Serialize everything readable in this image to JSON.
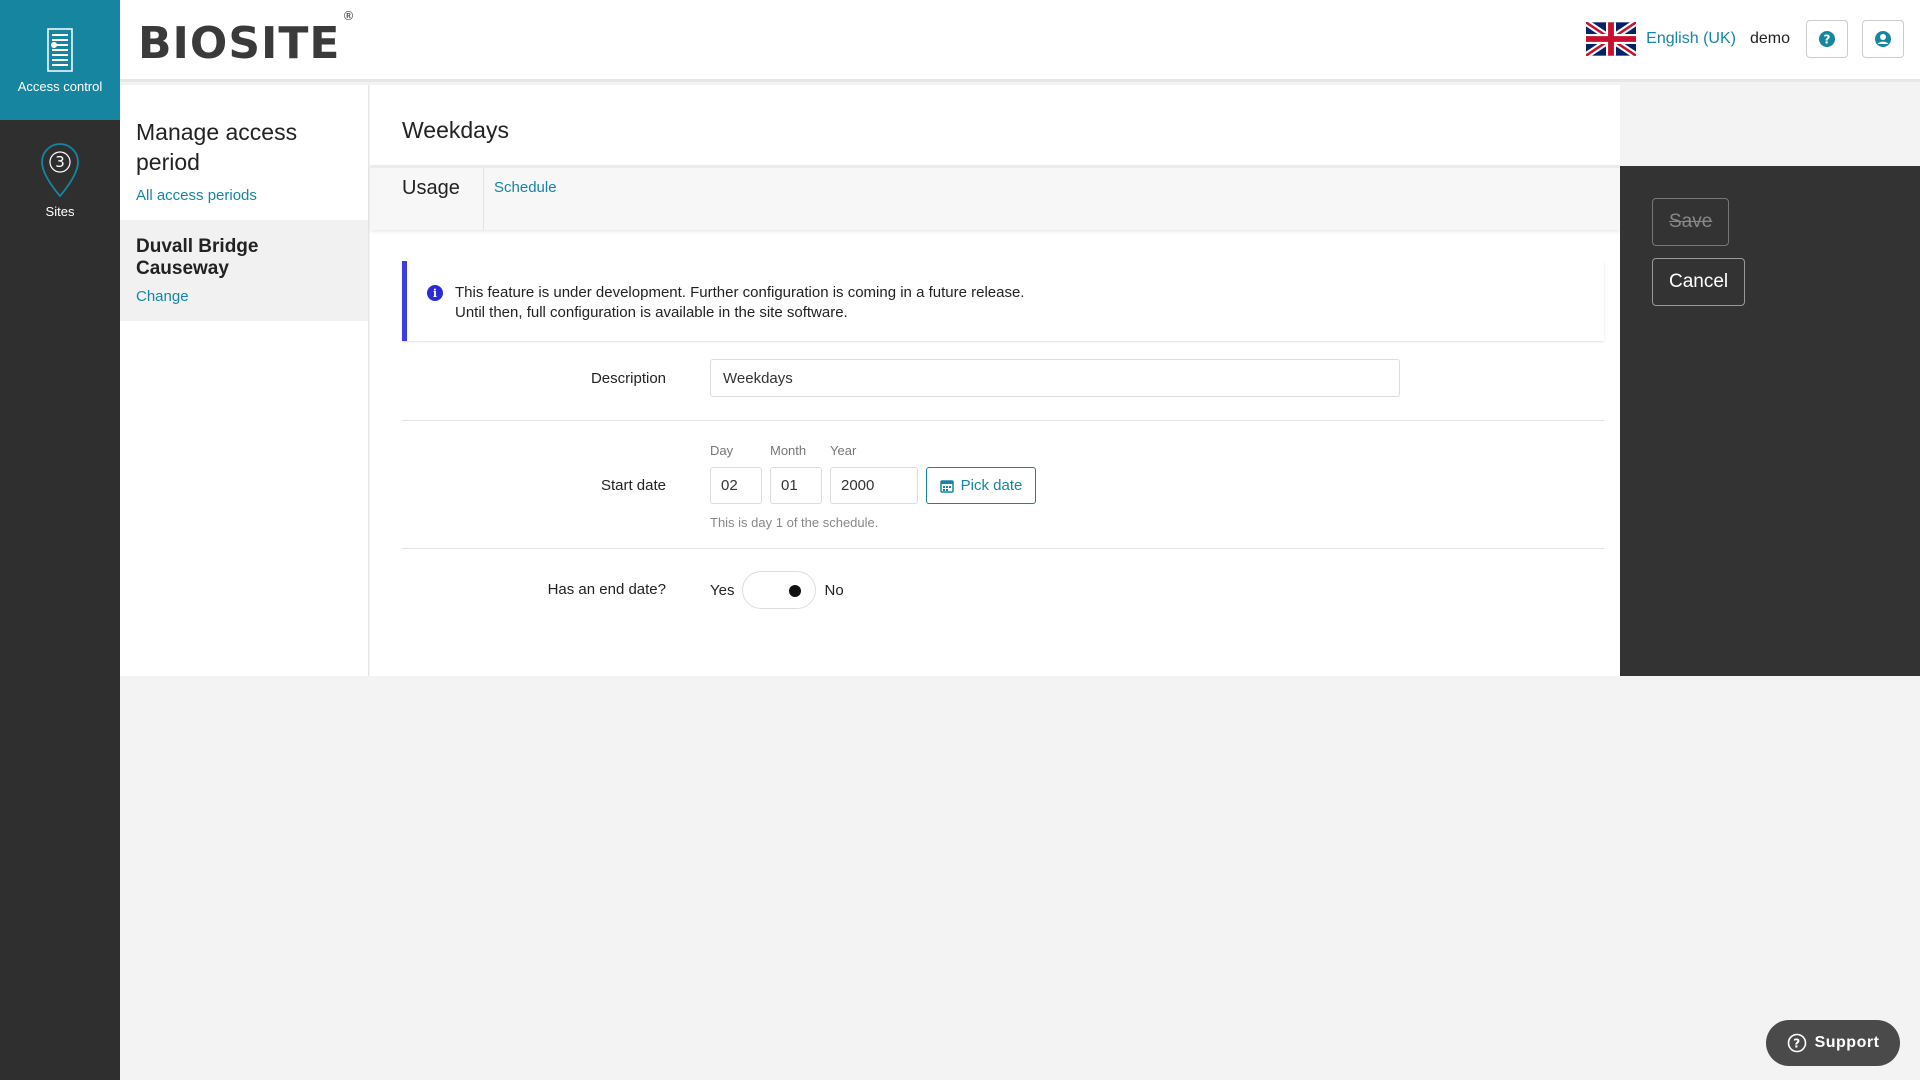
{
  "rail": {
    "items": [
      {
        "label": "Access control",
        "icon": "access-control-icon",
        "active": true
      },
      {
        "label": "Sites",
        "icon": "map-pin-icon",
        "badge": "3"
      }
    ]
  },
  "header": {
    "logo_text": "BIOSITE",
    "logo_mark": "®",
    "language": "English (UK)",
    "username": "demo",
    "help_icon": "help-icon",
    "account_icon": "user-icon"
  },
  "sidebar": {
    "title": "Manage access period",
    "back_link": "All access periods",
    "site_name": "Duvall Bridge Causeway",
    "change_link": "Change"
  },
  "main": {
    "title": "Weekdays",
    "tabs": [
      {
        "label": "Usage",
        "active": true
      },
      {
        "label": "Schedule",
        "active": false
      }
    ],
    "alert": {
      "line1": "This feature is under development. Further configuration is coming in a future release.",
      "line2": "Until then, full configuration is available in the site software."
    },
    "description": {
      "label": "Description",
      "value": "Weekdays"
    },
    "start_date": {
      "label": "Start date",
      "day_label": "Day",
      "day": "02",
      "month_label": "Month",
      "month": "01",
      "year_label": "Year",
      "year": "2000",
      "pick_label": "Pick date",
      "hint": "This is day 1 of the schedule."
    },
    "end_date": {
      "label": "Has an end date?",
      "yes": "Yes",
      "no": "No",
      "value": "No"
    }
  },
  "actions": {
    "save_label": "Save",
    "cancel_label": "Cancel"
  },
  "support_label": "Support",
  "colors": {
    "accent": "#1686a0",
    "rail": "#2f2f2f",
    "info": "#3c3ce0",
    "panel": "#333333"
  }
}
